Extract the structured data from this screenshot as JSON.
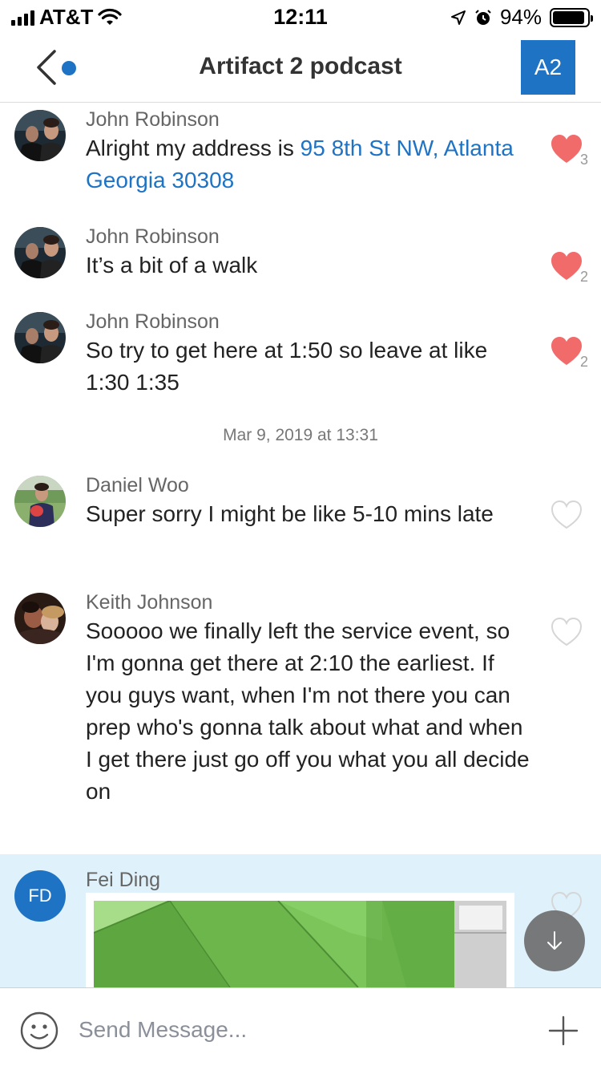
{
  "status_bar": {
    "carrier": "AT&T",
    "time": "12:11",
    "battery": "94%",
    "battery_level": 0.94,
    "icons": [
      "signal-icon",
      "wifi-icon",
      "location-icon",
      "alarm-icon",
      "battery-icon"
    ]
  },
  "header": {
    "title": "Artifact 2 podcast",
    "group_initials": "A2",
    "accent_color": "#1f73c4",
    "unread_indicator": true
  },
  "messages": [
    {
      "sender": "John Robinson",
      "text_before": "Alright my address is ",
      "link": "95 8th St NW, Atlanta Georgia 30308",
      "liked": true,
      "like_count": "3"
    },
    {
      "sender": "John Robinson",
      "text": "It’s a bit of a walk",
      "liked": true,
      "like_count": "2"
    },
    {
      "sender": "John Robinson",
      "text": "So try to get here at 1:50 so leave at like 1:30 1:35",
      "liked": true,
      "like_count": "2"
    },
    {
      "sender": "Daniel Woo",
      "text": "Super sorry I might be like 5-10 mins late",
      "liked": false
    },
    {
      "sender": "Keith Johnson",
      "text": "Sooooo we finally left the service event, so I'm gonna get there at 2:10 the earliest. If you guys want, when I'm not there you can prep who's gonna talk about what and when I get there just go off you what you all decide on",
      "liked": false
    },
    {
      "sender": "Fei Ding",
      "initials": "FD",
      "liked": false,
      "attachment": "image"
    }
  ],
  "timestamp": "Mar 9, 2019 at 13:31",
  "composer": {
    "placeholder": "Send Message..."
  },
  "colors": {
    "like_active": "#f26b6b",
    "like_inactive": "#d8d8d8",
    "highlight_bg": "#dff2fb",
    "link": "#1f73c4"
  }
}
